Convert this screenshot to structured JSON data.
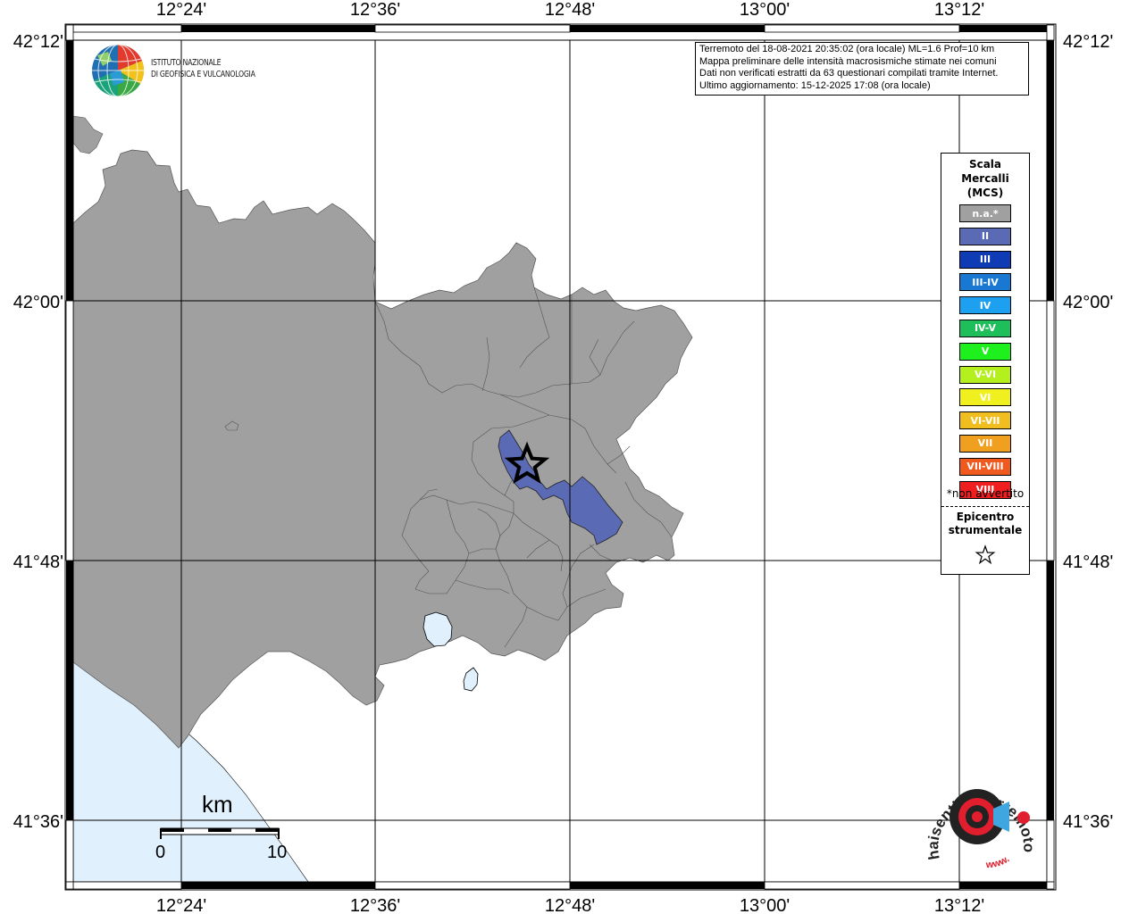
{
  "map": {
    "top_lon_labels": [
      "12°24'",
      "12°36'",
      "12°48'",
      "13°00'",
      "13°12'"
    ],
    "bottom_lon_labels": [
      "12°24'",
      "12°36'",
      "12°48'",
      "13°00'",
      "13°12'"
    ],
    "left_lat_labels": [
      "42°12'",
      "42°00'",
      "41°48'",
      "41°36'"
    ],
    "right_lat_labels": [
      "42°12'",
      "42°00'",
      "41°48'",
      "41°36'"
    ],
    "colors": {
      "land": "#a0a0a0",
      "sea": "#e0f0fc",
      "lakes": "#e0f0fc",
      "intensity_ii": "#5a6ab4",
      "grid": "#000000"
    },
    "epicenter_icon": "star-icon"
  },
  "info": {
    "line1": "Terremoto del 18-08-2021 20:35:02 (ora locale) ML=1.6 Prof=10 km",
    "line2": "Mappa preliminare delle intensità macrosismiche stimate nei comuni",
    "line3": "Dati non verificati estratti da 63 questionari compilati tramite Internet.",
    "line4": "Ultimo aggiornamento: 15-12-2025 17:08 (ora locale)"
  },
  "ingv_logo": {
    "line1": "Istituto Nazionale",
    "line2": "di Geofisica e Vulcanologia"
  },
  "legend": {
    "title1": "Scala",
    "title2": "Mercalli",
    "title3": "(MCS)",
    "items": [
      {
        "label": "n.a.*",
        "color": "#a0a0a0"
      },
      {
        "label": "II",
        "color": "#5a6ab4"
      },
      {
        "label": "III",
        "color": "#0f3cb4"
      },
      {
        "label": "III-IV",
        "color": "#1978d2"
      },
      {
        "label": "IV",
        "color": "#1ea0f0"
      },
      {
        "label": "IV-V",
        "color": "#1ebe5a"
      },
      {
        "label": "V",
        "color": "#1ef01e"
      },
      {
        "label": "V-VI",
        "color": "#b4f01e"
      },
      {
        "label": "VI",
        "color": "#f0f01e"
      },
      {
        "label": "VI-VII",
        "color": "#f0be1e"
      },
      {
        "label": "VII",
        "color": "#f0a01e"
      },
      {
        "label": "VII-VIII",
        "color": "#f05a1e"
      },
      {
        "label": "VIII",
        "color": "#f01e1e"
      }
    ],
    "note": "*non avvertito",
    "epicenter1": "Epicentro",
    "epicenter2": "strumentale"
  },
  "scale": {
    "unit": "km",
    "start": "0",
    "end": "10"
  },
  "hst_logo": {
    "text": "haisentitoilterremoto.it",
    "url_text": "www."
  }
}
